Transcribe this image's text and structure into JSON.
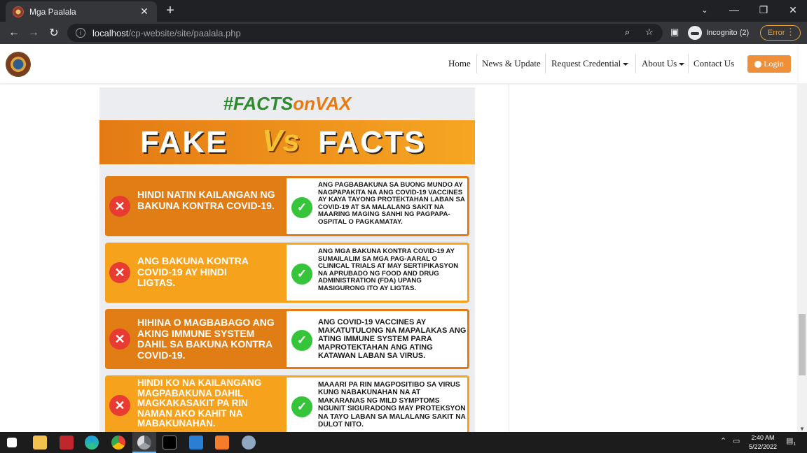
{
  "browser": {
    "tab_title": "Mga Paalala",
    "tab_close": "✕",
    "new_tab": "+",
    "url_host": "localhost",
    "url_path": "/cp-website/site/paalala.php",
    "incognito_label": "Incognito (2)",
    "error_label": "Error",
    "window_controls": [
      "—",
      "❐",
      "✕"
    ],
    "icons": [
      "back-icon",
      "forward-icon",
      "reload-icon",
      "zoom-icon",
      "bookmark-star-icon",
      "side-panel-icon",
      "menu-dots-icon"
    ]
  },
  "site": {
    "nav": {
      "home": "Home",
      "news": "News & Update",
      "request": "Request Credential",
      "about": "About Us",
      "contact": "Contact Us",
      "login": "Login"
    }
  },
  "poster": {
    "hashtag_part1": "#FACTS",
    "hashtag_part2": "on",
    "hashtag_part3": "VAX",
    "fake": "FAKE",
    "vs": "Vs",
    "facts": "FACTS",
    "rows": [
      {
        "fake": "HINDI NATIN KAILANGAN NG BAKUNA KONTRA COVID-19.",
        "fact": "ANG PAGBABAKUNA SA BUONG MUNDO AY NAGPAPAKITA NA ANG COVID-19 VACCINES AY KAYA TAYONG PROTEKTAHAN LABAN SA COVID-19 AT SA MALALANG SAKIT NA MAARING MAGING SANHI NG PAGPAPA-OSPITAL O PAGKAMATAY."
      },
      {
        "fake": "ANG BAKUNA KONTRA COVID-19 AY HINDI LIGTAS.",
        "fact": "ANG MGA BAKUNA KONTRA COVID-19 AY SUMAILALIM SA MGA PAG-AARAL O CLINICAL TRIALS AT MAY SERTIPIKASYON NA APRUBADO NG FOOD AND DRUG ADMINISTRATION (FDA) UPANG MASIGURONG ITO AY LIGTAS."
      },
      {
        "fake": "HIHINA O MAGBABAGO ANG AKING IMMUNE SYSTEM DAHIL SA BAKUNA KONTRA COVID-19.",
        "fact": "ANG COVID-19 VACCINES AY MAKATUTULONG NA MAPALAKAS ANG ATING IMMUNE SYSTEM PARA MAPROTEKTAHAN ANG ATING KATAWAN LABAN SA VIRUS."
      },
      {
        "fake": "HINDI KO NA KAILANGANG MAGPABAKUNA DAHIL MAGKAKASAKIT PA RIN NAMAN AKO KAHIT NA MABAKUNAHAN.",
        "fact": "MAAARI PA RIN MAGPOSITIBO SA VIRUS KUNG NABAKUNAHAN NA AT MAKARANAS NG MILD SYMPTOMS NGUNIT SIGURADONG MAY PROTEKSYON NA TAYO LABAN SA MALALANG SAKIT NA DULOT NITO."
      }
    ]
  },
  "taskbar": {
    "time": "2:40 AM",
    "date": "5/22/2022",
    "notification_count": "1"
  }
}
